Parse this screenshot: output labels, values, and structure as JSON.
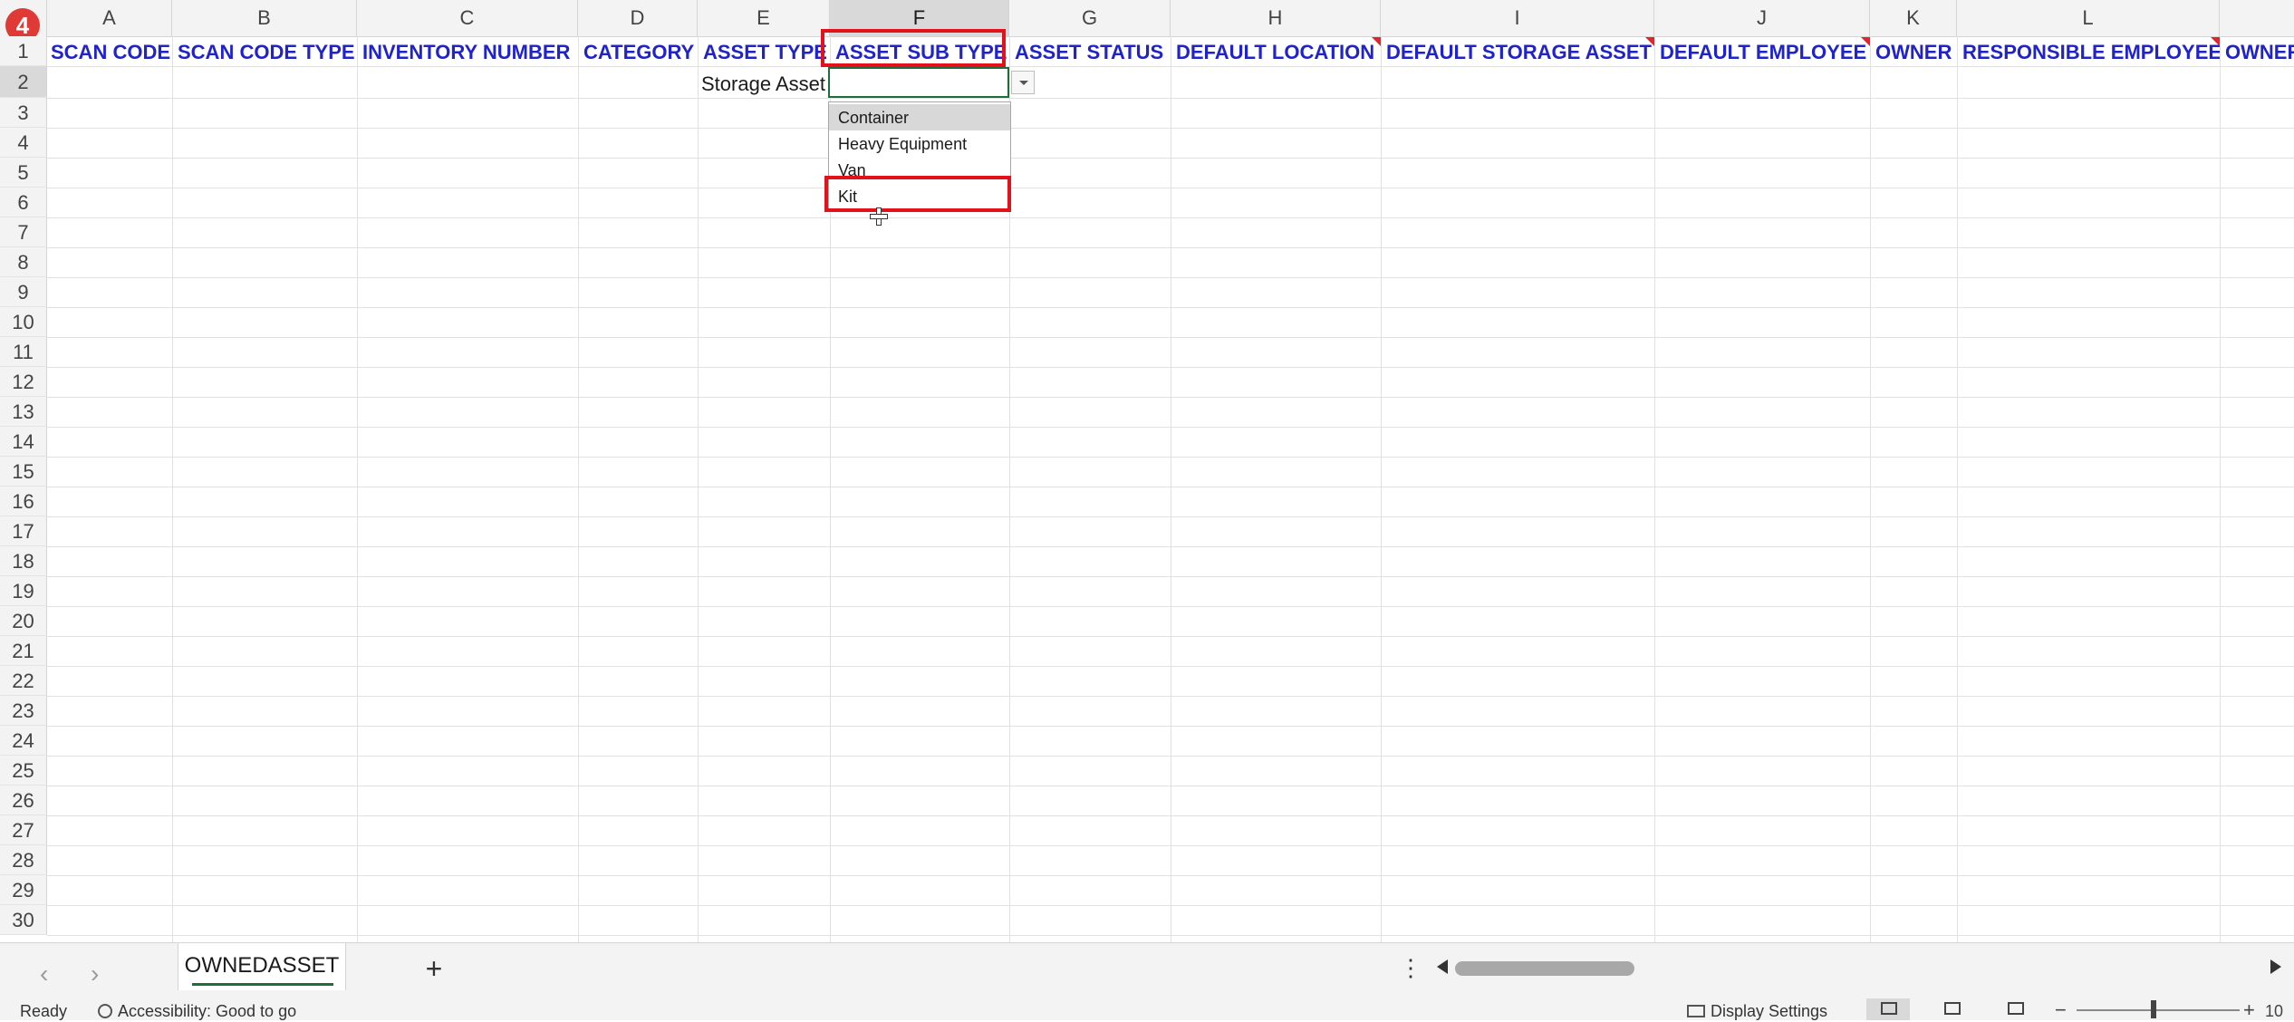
{
  "badge": "4",
  "columns": [
    "A",
    "B",
    "C",
    "D",
    "E",
    "F",
    "G",
    "H",
    "I",
    "J",
    "K",
    "L"
  ],
  "rows": [
    "1",
    "2",
    "3",
    "4",
    "5",
    "6",
    "7",
    "8",
    "9",
    "10",
    "11",
    "12",
    "13",
    "14",
    "15",
    "16",
    "17",
    "18",
    "19",
    "20",
    "21",
    "22",
    "23",
    "24",
    "25",
    "26",
    "27",
    "28",
    "29",
    "30"
  ],
  "headers": {
    "a": "SCAN CODE",
    "b": "SCAN CODE TYPE",
    "c": "INVENTORY NUMBER",
    "d": "CATEGORY",
    "e": "ASSET TYPE",
    "f": "ASSET SUB TYPE",
    "g": "ASSET STATUS",
    "h": "DEFAULT LOCATION",
    "i": "DEFAULT STORAGE ASSET",
    "j": "DEFAULT EMPLOYEE",
    "k": "OWNER",
    "l": "RESPONSIBLE EMPLOYEE",
    "m": "OWNER"
  },
  "cells": {
    "e2": "Storage Asset",
    "f2": ""
  },
  "dropdown": {
    "options": [
      "Container",
      "Heavy Equipment",
      "Van",
      "Kit"
    ],
    "highlighted": "Container",
    "boxed": "Kit"
  },
  "sheet": {
    "active_tab": "OWNEDASSET",
    "add": "+"
  },
  "status": {
    "ready": "Ready",
    "accessibility": "Accessibility: Good to go",
    "display_settings": "Display Settings",
    "zoom_minus": "−",
    "zoom_plus": "+",
    "zoom": "10"
  },
  "colors": {
    "header_text": "#1f23c8",
    "highlight": "#e3111c",
    "active_border": "#1e6e3c"
  }
}
